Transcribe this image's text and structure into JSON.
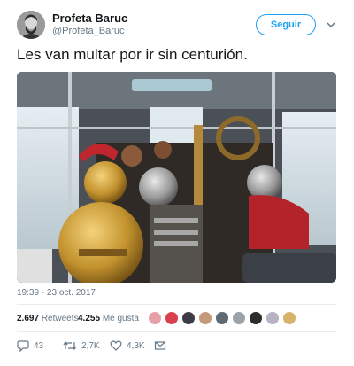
{
  "tweet": {
    "author_name": "Profeta Baruc",
    "author_handle": "@Profeta_Baruc",
    "follow_label": "Seguir",
    "text": "Les van multar por ir sin centurión.",
    "timestamp": "19:39 - 23 oct. 2017",
    "retweets_count": "2.697",
    "retweets_label": "Retweets",
    "likes_count": "4.255",
    "likes_label": "Me gusta",
    "reply_count": "43",
    "retweet_action_count": "2,7K",
    "like_action_count": "4,3K"
  },
  "colors": {
    "accent": "#1da1f2",
    "text": "#14171a",
    "secondary": "#657786",
    "divider": "#e6ecf0"
  },
  "icons": [
    "chevron-down-icon",
    "reply-icon",
    "retweet-icon",
    "heart-icon",
    "message-icon"
  ]
}
